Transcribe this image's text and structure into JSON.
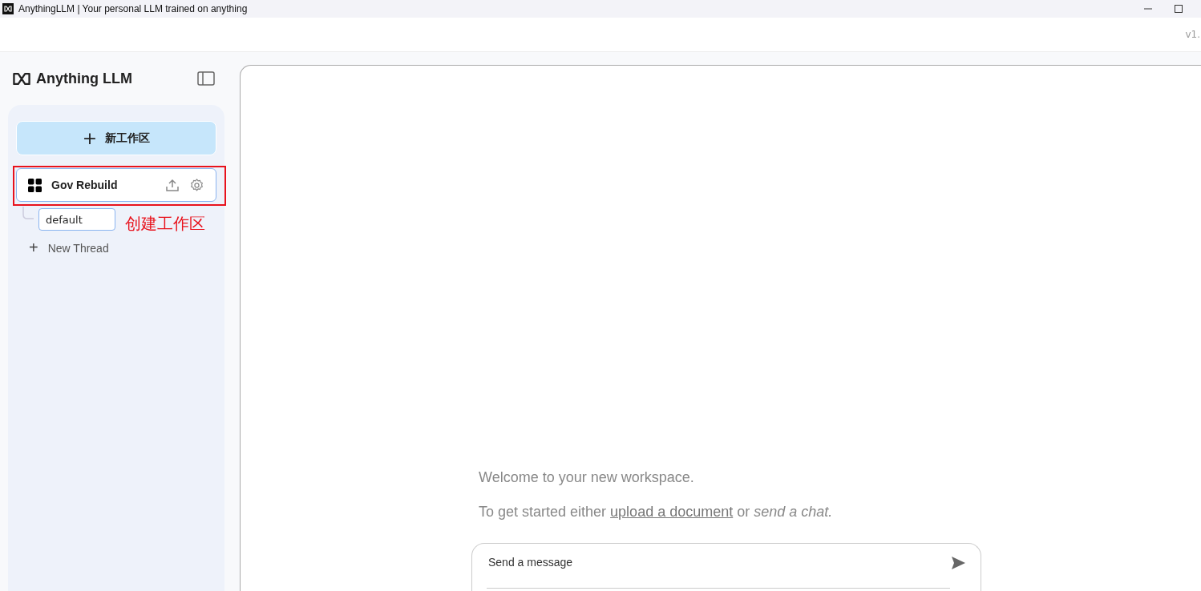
{
  "window": {
    "title": "AnythingLLM | Your personal LLM trained on anything"
  },
  "top_bar": {
    "version": "v1."
  },
  "sidebar": {
    "logo": "Anything LLM",
    "new_workspace_button": {
      "icon": "+",
      "label": "新工作区"
    },
    "workspaces": [
      {
        "name": "Gov Rebuild",
        "selected": true,
        "threads": [
          {
            "name": "default",
            "selected": true
          }
        ],
        "new_thread": {
          "icon": "+",
          "label": "New Thread"
        }
      }
    ]
  },
  "annotation": {
    "label": "创建工作区"
  },
  "main": {
    "welcome": "Welcome to your new workspace.",
    "hint": {
      "prefix": "To get started either",
      "link": "upload a document",
      "middle": "or",
      "emphasis": "send a chat."
    },
    "message_input": {
      "placeholder": "Send a message"
    }
  }
}
